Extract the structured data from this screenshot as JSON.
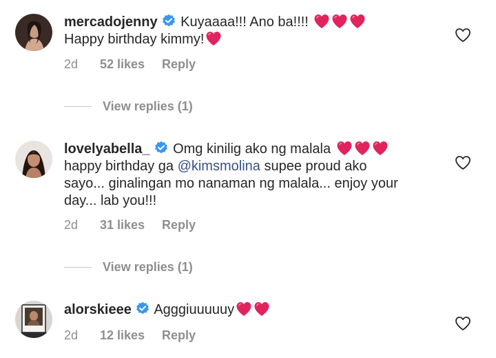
{
  "comments": [
    {
      "username": "mercadojenny",
      "verified": true,
      "text": "Kuyaaaa!!! Ano ba!!!! ",
      "line2": "Happy birthday kimmy!",
      "time": "2d",
      "likes": "52 likes",
      "reply": "Reply"
    },
    {
      "username": "lovelyabella_",
      "verified": true,
      "text_a": "Omg kinilig ako ng malala ",
      "text_b": "happy birthday ga ",
      "mention": "@kimsmolina",
      "text_c": " supee proud ako",
      "text_d": "sayo... ginalingan mo nanaman ng malala... enjoy your",
      "text_e": "day... lab you!!!",
      "time": "2d",
      "likes": "31 likes",
      "reply": "Reply"
    },
    {
      "username": "alorskieee",
      "verified": true,
      "text": "Agggiuuuuuy",
      "time": "2d",
      "likes": "12 likes",
      "reply": "Reply"
    }
  ],
  "view_replies": [
    "View replies (1)",
    "View replies (1)"
  ],
  "colors": {
    "text": "#262626",
    "secondary": "#8e8e8e",
    "verified_blue": "#3897f0",
    "mention": "#385185",
    "heart_red": "#e0245e"
  },
  "icons": [
    "verified-badge-icon",
    "heart-emoji-icon",
    "heart-outline-icon"
  ]
}
